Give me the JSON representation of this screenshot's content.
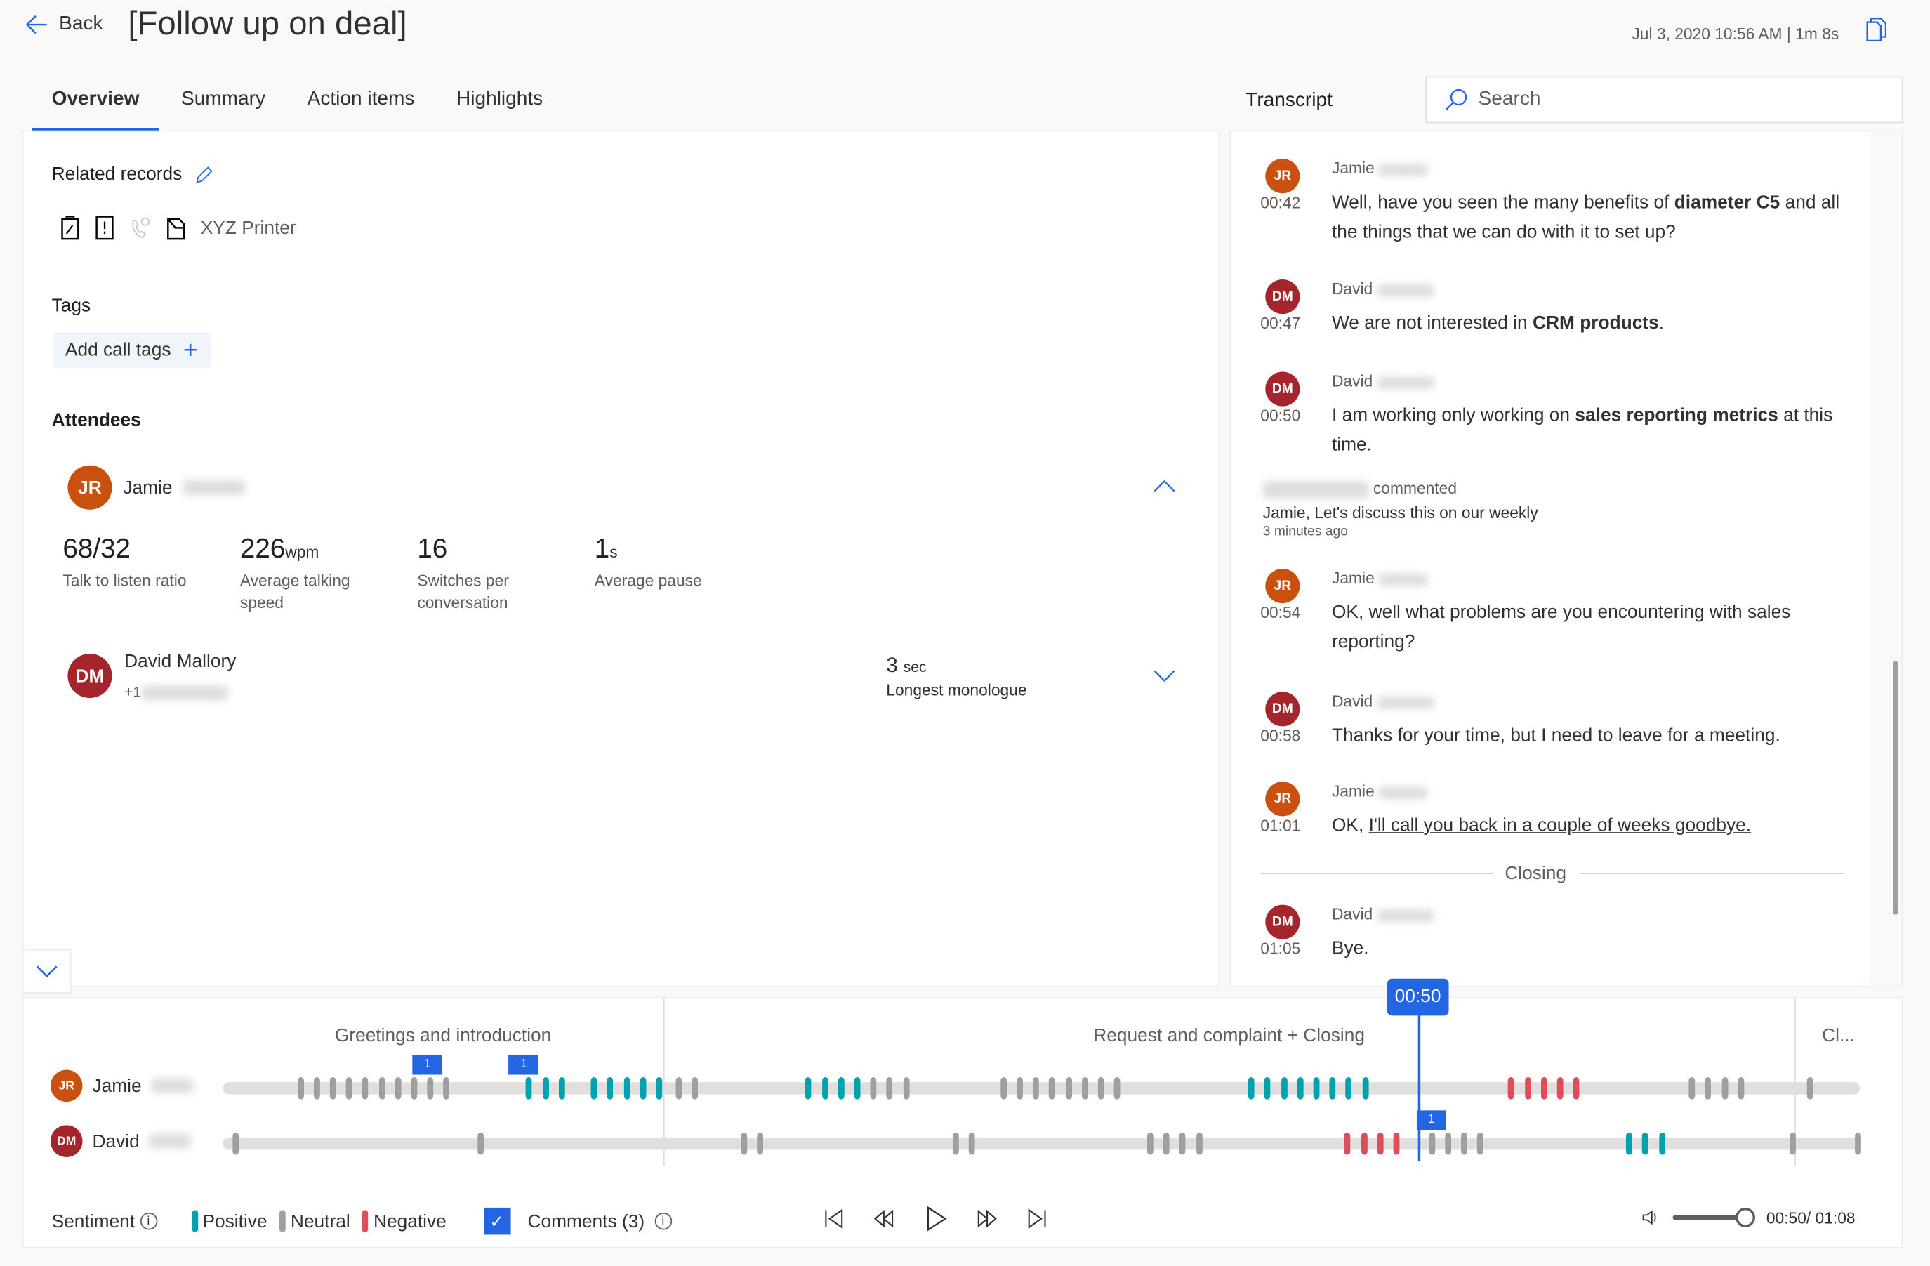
{
  "header": {
    "back_label": "Back",
    "title": "[Follow up on deal]",
    "datetime": "Jul 3, 2020 10:56 AM",
    "duration": "1m 8s",
    "separator": "|"
  },
  "tabs": [
    {
      "label": "Overview",
      "active": true
    },
    {
      "label": "Summary"
    },
    {
      "label": "Action items"
    },
    {
      "label": "Highlights"
    }
  ],
  "overview": {
    "related_records_label": "Related records",
    "record_name": "XYZ Printer",
    "tags_label": "Tags",
    "add_tags_label": "Add call tags",
    "attendees_label": "Attendees",
    "attendees": [
      {
        "initials": "JR",
        "first_name": "Jamie",
        "expanded": true,
        "stats": [
          {
            "value": "68/32",
            "unit": "",
            "label": "Talk to listen ratio"
          },
          {
            "value": "226",
            "unit": "wpm",
            "label": "Average talking speed"
          },
          {
            "value": "16",
            "unit": "",
            "label": "Switches per conversation"
          },
          {
            "value": "1",
            "unit": "s",
            "label": "Average pause"
          }
        ]
      },
      {
        "initials": "DM",
        "name": "David Mallory",
        "phone_prefix": "+1",
        "expanded": false,
        "stat": {
          "value": "3",
          "unit": "sec",
          "label": "Longest monologue"
        }
      }
    ]
  },
  "transcript": {
    "label": "Transcript",
    "search_placeholder": "Search",
    "entries": [
      {
        "initials": "JR",
        "name": "Jamie",
        "time": "00:42",
        "parts": [
          "Well, have you seen the many benefits of ",
          "diameter C5",
          " and all the things that we can do with it to set up?"
        ]
      },
      {
        "initials": "DM",
        "name": "David",
        "time": "00:47",
        "parts": [
          "We are not interested in ",
          "CRM products",
          "."
        ]
      },
      {
        "initials": "DM",
        "name": "David",
        "time": "00:50",
        "parts": [
          "I am working only working on ",
          "sales reporting metrics",
          " at this time."
        ]
      },
      {
        "initials": "JR",
        "name": "Jamie",
        "time": "00:54",
        "parts": [
          "OK, well what problems are you encountering with sales reporting?",
          "",
          ""
        ]
      },
      {
        "initials": "DM",
        "name": "David",
        "time": "00:58",
        "parts": [
          "Thanks for your time, but I need to leave for a meeting.",
          "",
          ""
        ]
      },
      {
        "initials": "JR",
        "name": "Jamie",
        "time": "01:01",
        "parts": [
          "OK, ",
          "I'll call you back in a couple of weeks goodbye.",
          ""
        ]
      },
      {
        "initials": "DM",
        "name": "David",
        "time": "01:05",
        "parts": [
          "Bye.",
          "",
          ""
        ]
      }
    ],
    "comment": {
      "action": "commented",
      "text": "Jamie, Let's discuss this on our weekly",
      "ago": "3 minutes ago"
    },
    "section_divider": "Closing"
  },
  "timeline": {
    "duration_s": 68,
    "current_s": 50,
    "current_label": "00:50",
    "sections": [
      {
        "label": "Greetings and introduction",
        "start_s": 0
      },
      {
        "label": "Request and complaint + Closing",
        "start_s": 18.3
      },
      {
        "label": "Cl...",
        "start_s": 65.3
      }
    ],
    "rows": [
      {
        "initials": "JR",
        "name": "Jamie",
        "groups": [
          [
            3.1,
            10,
            "neutral"
          ],
          [
            12.6,
            3,
            "positive"
          ],
          [
            15.3,
            5,
            "positive"
          ],
          [
            18.8,
            2,
            "neutral"
          ],
          [
            24.2,
            4,
            "positive"
          ],
          [
            26.9,
            3,
            "neutral"
          ],
          [
            32.3,
            8,
            "neutral"
          ],
          [
            42.6,
            8,
            "positive"
          ],
          [
            53.4,
            5,
            "negative"
          ],
          [
            60.9,
            4,
            "neutral"
          ],
          [
            65.8,
            1,
            "neutral"
          ]
        ],
        "comments": [
          [
            8.5,
            "1"
          ],
          [
            12.5,
            "1"
          ]
        ]
      },
      {
        "initials": "DM",
        "name": "David",
        "groups": [
          [
            0.4,
            1,
            "neutral"
          ],
          [
            10.6,
            1,
            "neutral"
          ],
          [
            21.5,
            2,
            "neutral"
          ],
          [
            30.3,
            2,
            "neutral"
          ],
          [
            38.4,
            4,
            "neutral"
          ],
          [
            46.6,
            4,
            "negative"
          ],
          [
            50.1,
            4,
            "neutral"
          ],
          [
            58.3,
            3,
            "positive"
          ],
          [
            65.1,
            1,
            "neutral"
          ],
          [
            67.8,
            1,
            "neutral"
          ]
        ],
        "comments": [
          [
            50.2,
            "1"
          ]
        ]
      }
    ],
    "legend": {
      "title": "Sentiment",
      "positive": "Positive",
      "neutral": "Neutral",
      "negative": "Negative"
    },
    "comments_toggle": {
      "label": "Comments (3)",
      "checked": true
    },
    "time_readout": "00:50/ 01:08",
    "volume": 0.9
  },
  "colors": {
    "accent": "#2266e3",
    "positive": "#00a2ad",
    "neutral": "#a19f9d",
    "negative": "#e04c59",
    "jr": "#ca5010",
    "dm": "#a4262c"
  }
}
